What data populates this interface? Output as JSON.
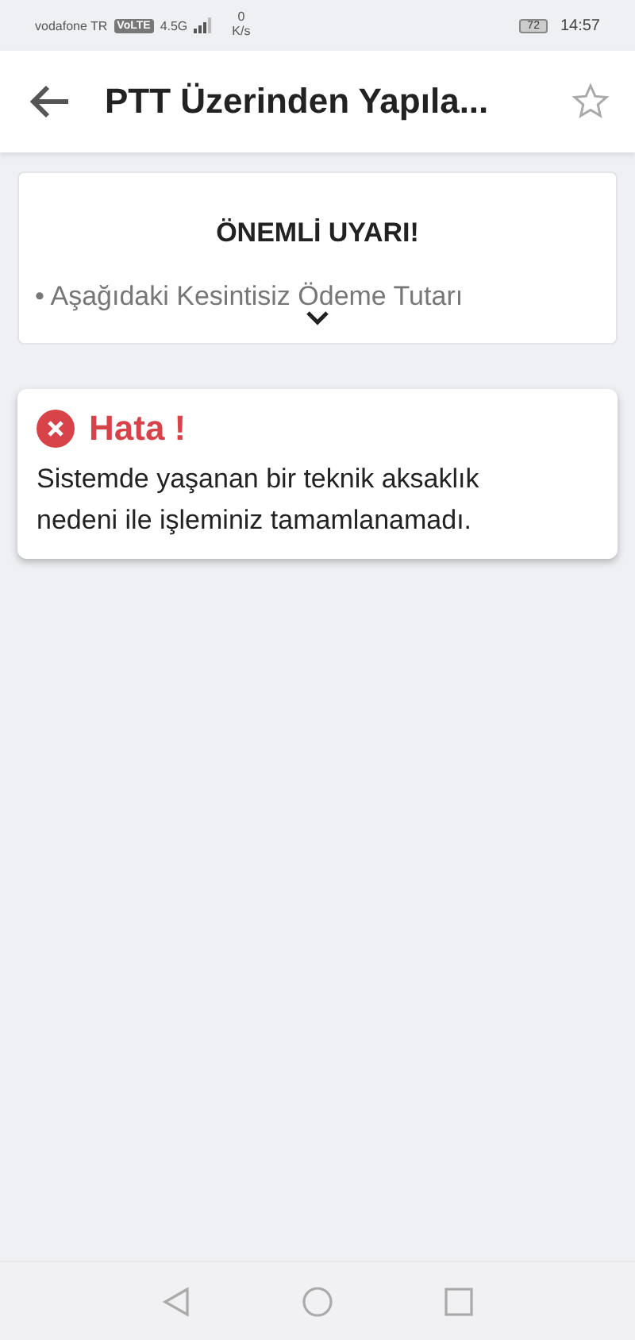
{
  "status_bar": {
    "carrier": "vodafone TR",
    "volte": "VoLTE",
    "network": "4.5G",
    "speed_value": "0",
    "speed_unit": "K/s",
    "battery": "72",
    "time": "14:57"
  },
  "app_bar": {
    "title": "PTT Üzerinden Yapıla...",
    "favorite": false
  },
  "notice": {
    "title": "ÖNEMLİ UYARI!",
    "bullet": "• Aşağıdaki Kesintisiz Ödeme Tutarı",
    "expanded": false
  },
  "error": {
    "title": "Hata !",
    "message": "Sistemde yaşanan bir teknik aksaklık nedeni ile işleminiz tamamlanamadı."
  }
}
